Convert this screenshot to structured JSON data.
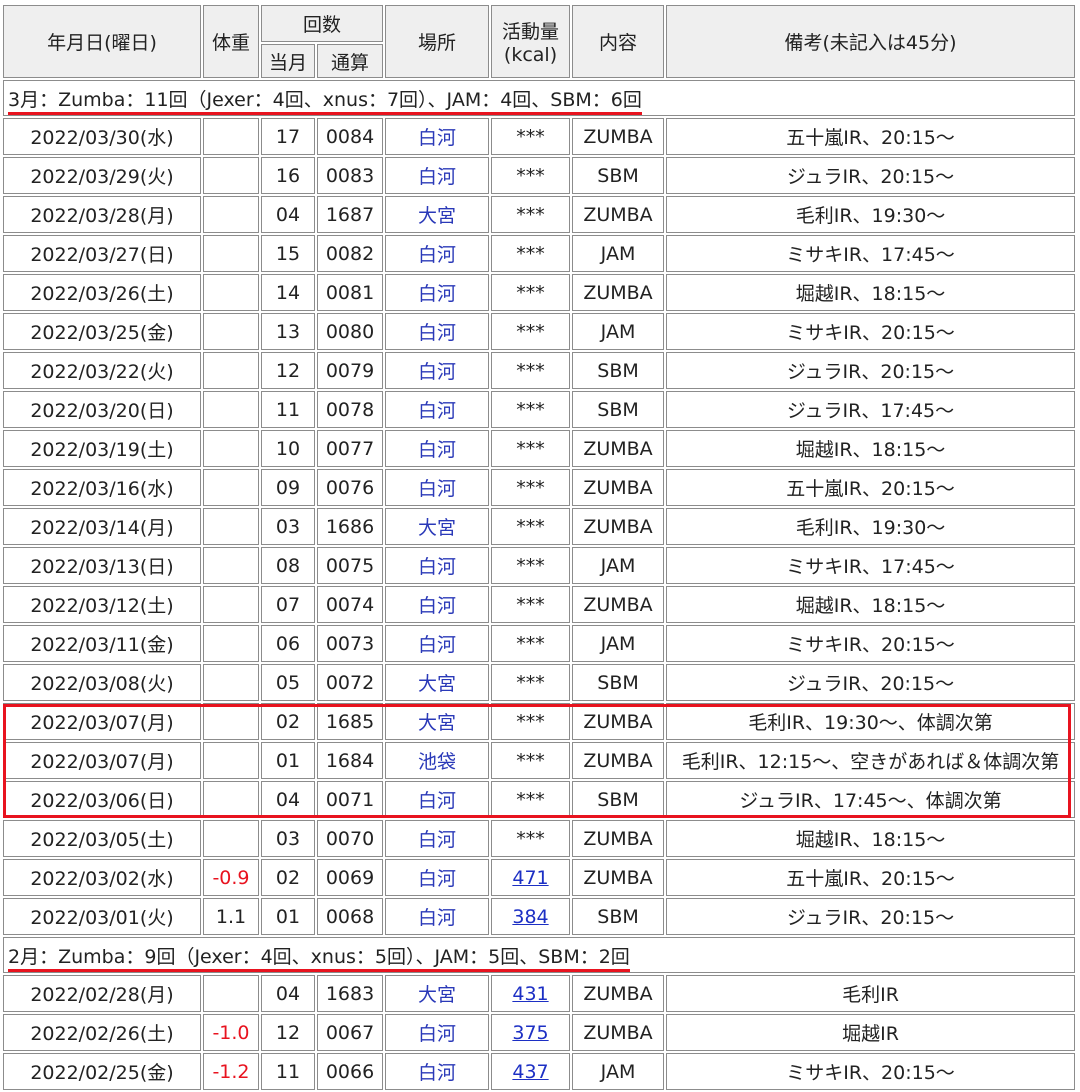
{
  "colors": {
    "accent": "#e8131f",
    "place": "#2a39b8",
    "link": "#1c2fc4",
    "negative": "#e8131f"
  },
  "header": {
    "date": "年月日(曜日)",
    "weight": "体重",
    "count": "回数",
    "count_month": "当月",
    "count_total": "通算",
    "place": "場所",
    "activity": "活動量",
    "activity_unit": "(kcal)",
    "content": "内容",
    "memo": "備考(未記入は45分)"
  },
  "sections": [
    {
      "summary": "3月：Zumba：11回（Jexer：4回、xnus：7回）、JAM：4回、SBM：6回",
      "rows": [
        {
          "date": "2022/03/30(水)",
          "weight": "",
          "month": "17",
          "total": "0084",
          "place": "白河",
          "kcal": "***",
          "content": "ZUMBA",
          "memo": "五十嵐IR、20:15～"
        },
        {
          "date": "2022/03/29(火)",
          "weight": "",
          "month": "16",
          "total": "0083",
          "place": "白河",
          "kcal": "***",
          "content": "SBM",
          "memo": "ジュラIR、20:15～"
        },
        {
          "date": "2022/03/28(月)",
          "weight": "",
          "month": "04",
          "total": "1687",
          "place": "大宮",
          "kcal": "***",
          "content": "ZUMBA",
          "memo": "毛利IR、19:30～"
        },
        {
          "date": "2022/03/27(日)",
          "weight": "",
          "month": "15",
          "total": "0082",
          "place": "白河",
          "kcal": "***",
          "content": "JAM",
          "memo": "ミサキIR、17:45～"
        },
        {
          "date": "2022/03/26(土)",
          "weight": "",
          "month": "14",
          "total": "0081",
          "place": "白河",
          "kcal": "***",
          "content": "ZUMBA",
          "memo": "堀越IR、18:15～"
        },
        {
          "date": "2022/03/25(金)",
          "weight": "",
          "month": "13",
          "total": "0080",
          "place": "白河",
          "kcal": "***",
          "content": "JAM",
          "memo": "ミサキIR、20:15～"
        },
        {
          "date": "2022/03/22(火)",
          "weight": "",
          "month": "12",
          "total": "0079",
          "place": "白河",
          "kcal": "***",
          "content": "SBM",
          "memo": "ジュラIR、20:15～"
        },
        {
          "date": "2022/03/20(日)",
          "weight": "",
          "month": "11",
          "total": "0078",
          "place": "白河",
          "kcal": "***",
          "content": "SBM",
          "memo": "ジュラIR、17:45～"
        },
        {
          "date": "2022/03/19(土)",
          "weight": "",
          "month": "10",
          "total": "0077",
          "place": "白河",
          "kcal": "***",
          "content": "ZUMBA",
          "memo": "堀越IR、18:15～"
        },
        {
          "date": "2022/03/16(水)",
          "weight": "",
          "month": "09",
          "total": "0076",
          "place": "白河",
          "kcal": "***",
          "content": "ZUMBA",
          "memo": "五十嵐IR、20:15～"
        },
        {
          "date": "2022/03/14(月)",
          "weight": "",
          "month": "03",
          "total": "1686",
          "place": "大宮",
          "kcal": "***",
          "content": "ZUMBA",
          "memo": "毛利IR、19:30～"
        },
        {
          "date": "2022/03/13(日)",
          "weight": "",
          "month": "08",
          "total": "0075",
          "place": "白河",
          "kcal": "***",
          "content": "JAM",
          "memo": "ミサキIR、17:45～"
        },
        {
          "date": "2022/03/12(土)",
          "weight": "",
          "month": "07",
          "total": "0074",
          "place": "白河",
          "kcal": "***",
          "content": "ZUMBA",
          "memo": "堀越IR、18:15～"
        },
        {
          "date": "2022/03/11(金)",
          "weight": "",
          "month": "06",
          "total": "0073",
          "place": "白河",
          "kcal": "***",
          "content": "JAM",
          "memo": "ミサキIR、20:15～"
        },
        {
          "date": "2022/03/08(火)",
          "weight": "",
          "month": "05",
          "total": "0072",
          "place": "大宮",
          "kcal": "***",
          "content": "SBM",
          "memo": "ジュラIR、20:15～"
        },
        {
          "date": "2022/03/07(月)",
          "weight": "",
          "month": "02",
          "total": "1685",
          "place": "大宮",
          "kcal": "***",
          "content": "ZUMBA",
          "memo": "毛利IR、19:30～、体調次第"
        },
        {
          "date": "2022/03/07(月)",
          "weight": "",
          "month": "01",
          "total": "1684",
          "place": "池袋",
          "kcal": "***",
          "content": "ZUMBA",
          "memo": "毛利IR、12:15～、空きがあれば＆体調次第"
        },
        {
          "date": "2022/03/06(日)",
          "weight": "",
          "month": "04",
          "total": "0071",
          "place": "白河",
          "kcal": "***",
          "content": "SBM",
          "memo": "ジュラIR、17:45～、体調次第"
        },
        {
          "date": "2022/03/05(土)",
          "weight": "",
          "month": "03",
          "total": "0070",
          "place": "白河",
          "kcal": "***",
          "content": "ZUMBA",
          "memo": "堀越IR、18:15～"
        },
        {
          "date": "2022/03/02(水)",
          "weight": "-0.9",
          "month": "02",
          "total": "0069",
          "place": "白河",
          "kcal": "471",
          "content": "ZUMBA",
          "memo": "五十嵐IR、20:15～"
        },
        {
          "date": "2022/03/01(火)",
          "weight": "1.1",
          "month": "01",
          "total": "0068",
          "place": "白河",
          "kcal": "384",
          "content": "SBM",
          "memo": "ジュラIR、20:15～"
        }
      ]
    },
    {
      "summary": "2月：Zumba：9回（Jexer：4回、xnus：5回）、JAM：5回、SBM：2回",
      "rows": [
        {
          "date": "2022/02/28(月)",
          "weight": "",
          "month": "04",
          "total": "1683",
          "place": "大宮",
          "kcal": "431",
          "content": "ZUMBA",
          "memo": "毛利IR"
        },
        {
          "date": "2022/02/26(土)",
          "weight": "-1.0",
          "month": "12",
          "total": "0067",
          "place": "白河",
          "kcal": "375",
          "content": "ZUMBA",
          "memo": "堀越IR"
        },
        {
          "date": "2022/02/25(金)",
          "weight": "-1.2",
          "month": "11",
          "total": "0066",
          "place": "白河",
          "kcal": "437",
          "content": "JAM",
          "memo": "ミサキIR、20:15～"
        }
      ]
    }
  ]
}
